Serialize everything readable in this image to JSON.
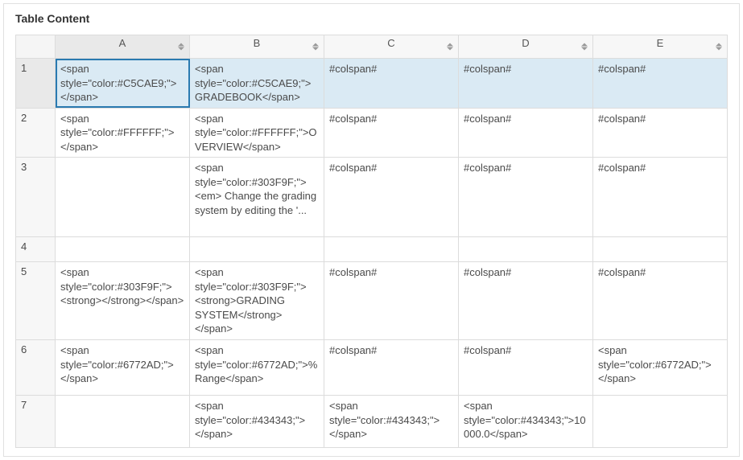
{
  "panel": {
    "title": "Table Content"
  },
  "columns": [
    "A",
    "B",
    "C",
    "D",
    "E"
  ],
  "activeColumn": 0,
  "selectedRow": 0,
  "selectedCol": 0,
  "rows": [
    {
      "num": "1",
      "cells": [
        "<span style=\"color:#C5CAE9;\"></span>",
        "<span style=\"color:#C5CAE9;\">GRADEBOOK</span>",
        "#colspan#",
        "#colspan#",
        "#colspan#"
      ]
    },
    {
      "num": "2",
      "cells": [
        "<span style=\"color:#FFFFFF;\"></span>",
        "<span style=\"color:#FFFFFF;\">OVERVIEW</span>",
        "#colspan#",
        "#colspan#",
        "#colspan#"
      ]
    },
    {
      "num": "3",
      "cells": [
        "",
        "<span style=\"color:#303F9F;\"><em>\nChange the grading system by editing the '...",
        "#colspan#",
        "#colspan#",
        "#colspan#"
      ]
    },
    {
      "num": "4",
      "cells": [
        "",
        "",
        "",
        "",
        ""
      ]
    },
    {
      "num": "5",
      "cells": [
        "<span style=\"color:#303F9F;\"><strong></strong></span>",
        "<span style=\"color:#303F9F;\"><strong>GRADING SYSTEM</strong></span>",
        "#colspan#",
        "#colspan#",
        "#colspan#"
      ]
    },
    {
      "num": "6",
      "cells": [
        "<span style=\"color:#6772AD;\"></span>",
        "<span style=\"color:#6772AD;\">% Range</span>",
        "#colspan#",
        "#colspan#",
        "<span style=\"color:#6772AD;\"></span>"
      ]
    },
    {
      "num": "7",
      "cells": [
        "",
        "<span style=\"color:#434343;\"></span>",
        "<span style=\"color:#434343;\"></span>",
        "<span style=\"color:#434343;\">10000.0</span>",
        ""
      ]
    }
  ]
}
